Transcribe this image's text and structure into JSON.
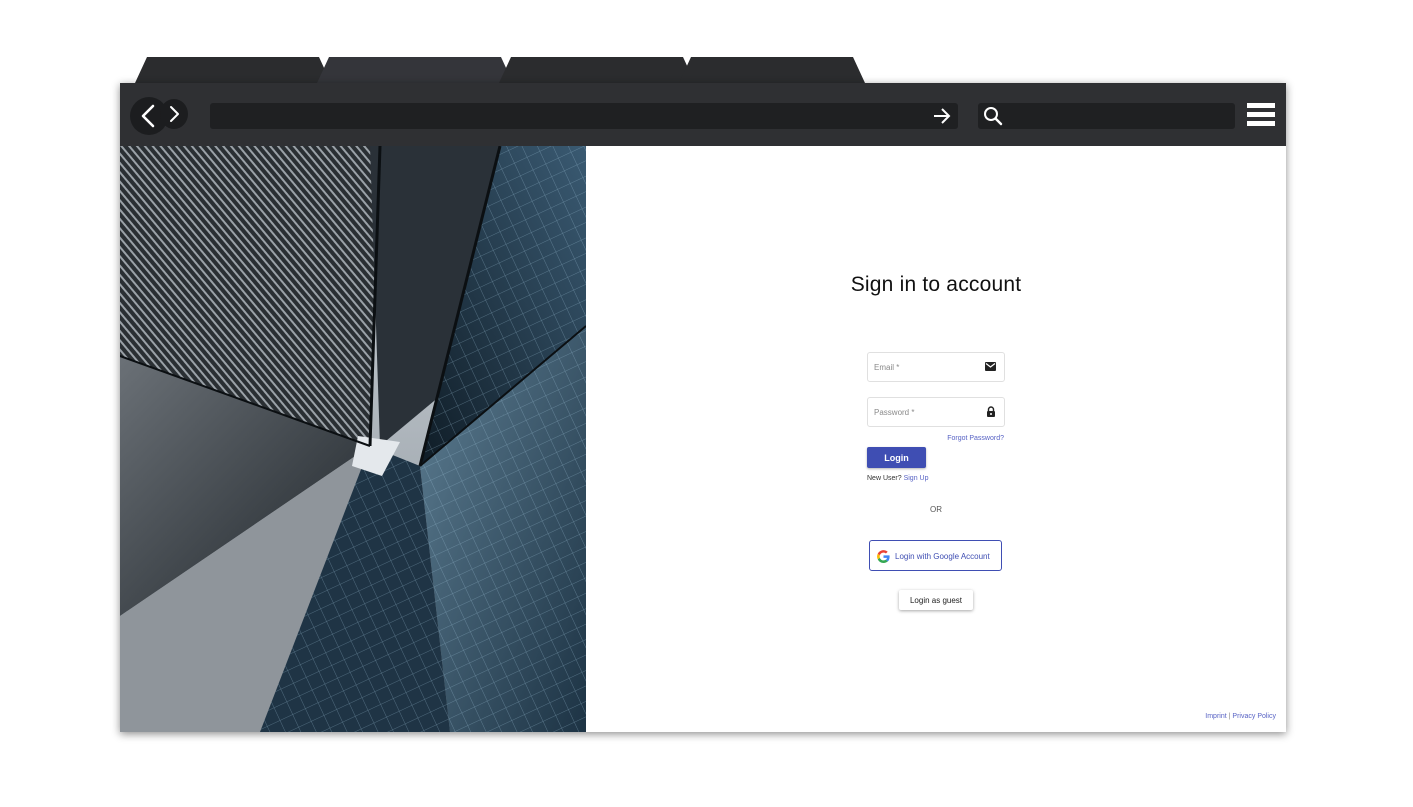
{
  "browser": {
    "tabs": [
      "",
      "",
      "",
      ""
    ],
    "url": "",
    "search": "",
    "icons": {
      "back": "chevron-left-icon",
      "forward": "chevron-right-icon",
      "go": "arrow-right-icon",
      "search": "search-icon",
      "menu": "hamburger-menu-icon"
    }
  },
  "login": {
    "title": "Sign in to account",
    "email_placeholder": "Email *",
    "password_placeholder": "Password *",
    "forgot_password": "Forgot Password?",
    "login_button": "Login",
    "new_user_text": "New User?",
    "sign_up_link": "Sign Up",
    "or_text": "OR",
    "google_button": "Login with Google Account",
    "guest_button": "Login as guest",
    "icons": {
      "email": "envelope-icon",
      "password": "lock-icon",
      "google": "google-g-icon"
    }
  },
  "footer": {
    "imprint": "Imprint",
    "separator": "|",
    "privacy": "Privacy Policy"
  },
  "colors": {
    "accent": "#3f4eb3",
    "link": "#5762c4",
    "toolbar": "#2f3033",
    "tab": "#2b2c2e"
  }
}
